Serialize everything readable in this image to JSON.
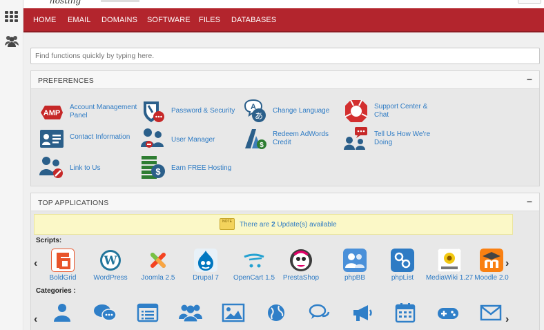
{
  "brand": {
    "logo_text": "hosting"
  },
  "nav": {
    "items": [
      "HOME",
      "EMAIL",
      "DOMAINS",
      "SOFTWARE",
      "FILES",
      "DATABASES"
    ]
  },
  "search": {
    "placeholder": "Find functions quickly by typing here."
  },
  "preferences": {
    "title": "PREFERENCES",
    "collapse": "−",
    "items": [
      {
        "label_lines": [
          "Account Management",
          "Panel"
        ],
        "icon": "amp-icon"
      },
      {
        "label_lines": [
          "Password & Security"
        ],
        "icon": "shield-lock-icon"
      },
      {
        "label_lines": [
          "Change Language"
        ],
        "icon": "language-icon"
      },
      {
        "label_lines": [
          "Support Center &",
          "Chat"
        ],
        "icon": "lifebuoy-icon"
      },
      {
        "label_lines": [
          "Contact Information"
        ],
        "icon": "contact-card-icon"
      },
      {
        "label_lines": [
          "User Manager"
        ],
        "icon": "user-manager-icon"
      },
      {
        "label_lines": [
          "Redeem AdWords",
          "Credit"
        ],
        "icon": "adwords-icon"
      },
      {
        "label_lines": [
          "Tell Us How We're",
          "Doing"
        ],
        "icon": "feedback-icon"
      },
      {
        "label_lines": [
          "Link to Us"
        ],
        "icon": "link-users-icon"
      },
      {
        "label_lines": [
          "Earn FREE Hosting"
        ],
        "icon": "earn-money-icon"
      }
    ]
  },
  "top_apps": {
    "title": "TOP APPLICATIONS",
    "collapse": "−",
    "notice": {
      "prefix": "There are ",
      "count": "2",
      "suffix": " Update(s) available",
      "badge": "NOTE"
    },
    "scripts_label": "Scripts:",
    "categories_label": "Categories :",
    "scripts": [
      {
        "name": "BoldGrid",
        "color": "#e8542a"
      },
      {
        "name": "WordPress",
        "color": "#21759b"
      },
      {
        "name": "Joomla 2.5",
        "color": "#f44321"
      },
      {
        "name": "Drupal 7",
        "color": "#0077c0"
      },
      {
        "name": "OpenCart 1.5",
        "color": "#23a1d1"
      },
      {
        "name": "PrestaShop",
        "color": "#df0067"
      },
      {
        "name": "phpBB",
        "color": "#4a90d9"
      },
      {
        "name": "phpList",
        "color": "#2e7bc4"
      },
      {
        "name": "MediaWiki 1.27",
        "color": "#f2c811"
      },
      {
        "name": "Moodle 2.0",
        "color": "#f98012"
      }
    ],
    "categories": [
      "user-icon",
      "chat-icon",
      "list-icon",
      "group-icon",
      "image-icon",
      "globe-icon",
      "comments-icon",
      "megaphone-icon",
      "calendar-icon",
      "gamepad-icon",
      "envelope-icon"
    ],
    "arrow_left": "‹",
    "arrow_right": "›"
  },
  "colors": {
    "nav_bg": "#b3252d",
    "link": "#2e7bc4",
    "category_icon": "#2f7fc8"
  }
}
